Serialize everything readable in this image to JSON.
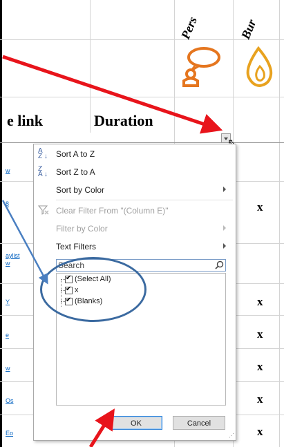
{
  "sheet": {
    "col_headers_rotated": [
      "Pers",
      "Bur"
    ],
    "header_link": "e link",
    "header_duration": "Duration",
    "x_mark": "x",
    "links": [
      "w",
      "8",
      "aylist",
      "w",
      "Y",
      "e",
      "w",
      "Os",
      "Eo"
    ]
  },
  "dropdown": {
    "sort_az": "Sort A to Z",
    "sort_za": "Sort Z to A",
    "sort_color": "Sort by Color",
    "clear_filter": "Clear Filter From \"(Column E)\"",
    "filter_color": "Filter by Color",
    "text_filters": "Text Filters",
    "search_placeholder": "Search",
    "items": [
      "(Select All)",
      "x",
      "(Blanks)"
    ],
    "ok": "OK",
    "cancel": "Cancel"
  },
  "colors": {
    "arrow_red": "#e8141b",
    "arrow_blue": "#4a7fc1",
    "icon_orange": "#e5761f",
    "oval_blue": "#3b6aa0"
  },
  "icons": [
    "speech-person-icon",
    "flame-drop-icon",
    "sort-az-icon",
    "sort-za-icon",
    "clear-filter-icon",
    "search-icon"
  ]
}
